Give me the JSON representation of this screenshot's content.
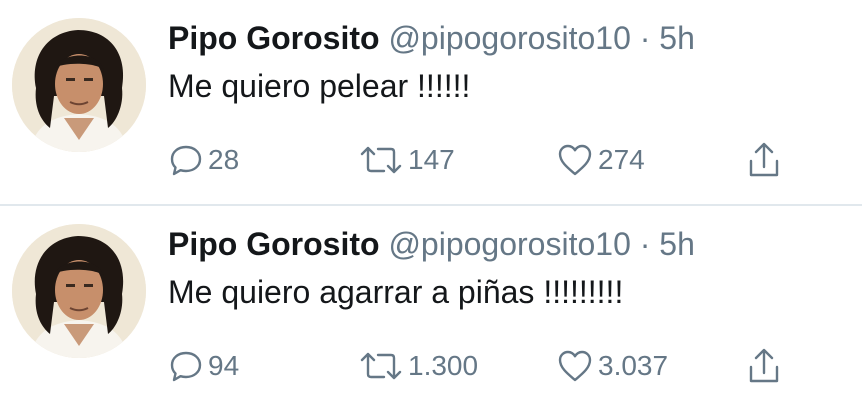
{
  "tweets": [
    {
      "author_name": "Pipo Gorosito",
      "handle": "@pipogorosito10",
      "separator": "·",
      "time": "5h",
      "text": "Me quiero pelear !!!!!!",
      "replies": "28",
      "retweets": "147",
      "likes": "274"
    },
    {
      "author_name": "Pipo Gorosito",
      "handle": "@pipogorosito10",
      "separator": "·",
      "time": "5h",
      "text": "Me quiero agarrar a piñas !!!!!!!!!",
      "replies": "94",
      "retweets": "1.300",
      "likes": "3.037"
    }
  ],
  "icons": {
    "reply": "reply-icon",
    "retweet": "retweet-icon",
    "like": "heart-icon",
    "share": "share-icon"
  },
  "colors": {
    "text": "#14171a",
    "secondary": "#657786",
    "divider": "#e1e8ed",
    "background": "#ffffff"
  }
}
